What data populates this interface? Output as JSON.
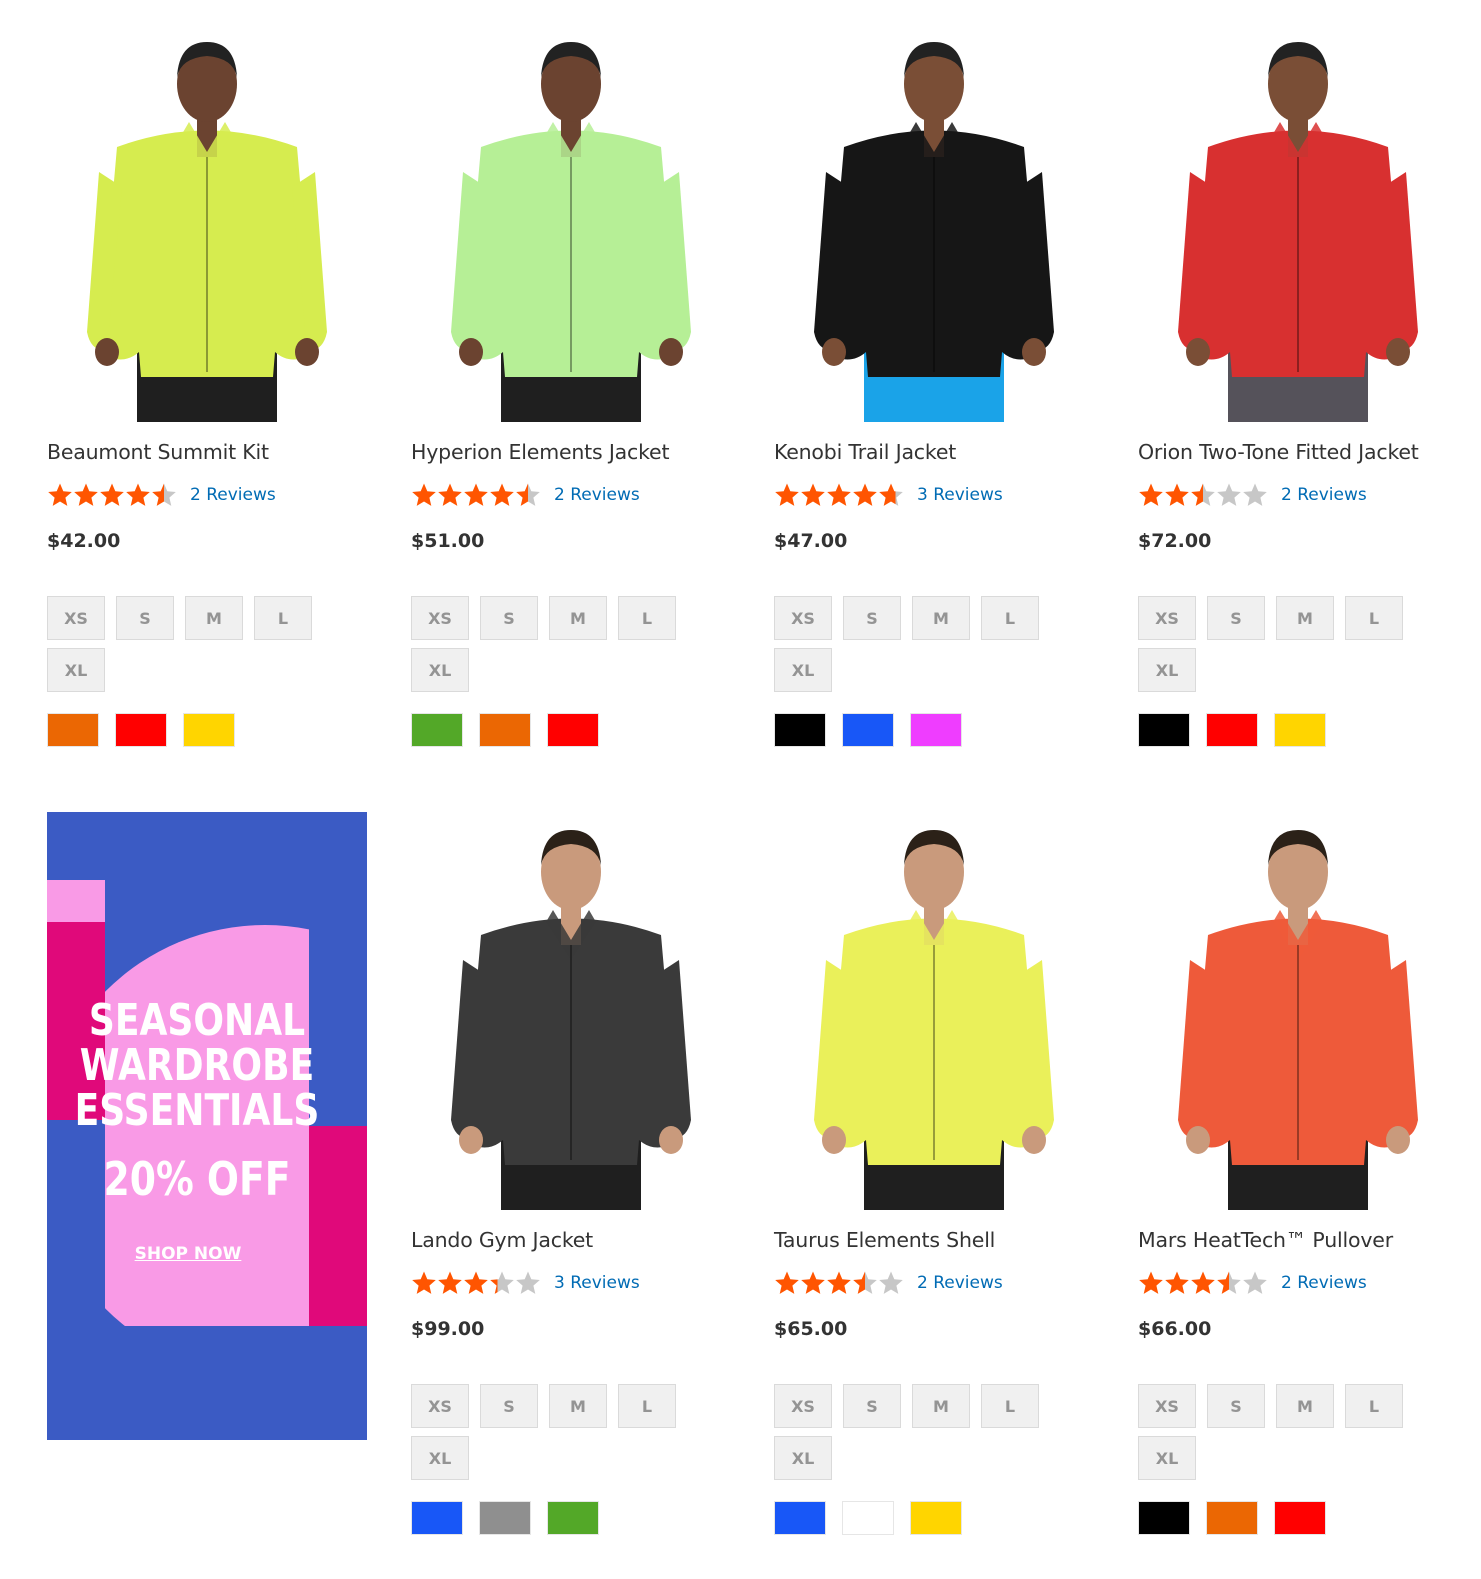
{
  "products": [
    {
      "name": "Beaumont Summit Kit",
      "rating": 4.5,
      "reviews": "2  Reviews",
      "price": "$42.00",
      "sizes": [
        "XS",
        "S",
        "M",
        "L",
        "XL"
      ],
      "colors": [
        "#eb6703",
        "#ff0000",
        "#ffd500"
      ],
      "jacket": "#d6ec4f",
      "pants": "#1f1f1f",
      "skin": "#6b4330",
      "hair": "#222"
    },
    {
      "name": "Hyperion Elements Jacket",
      "rating": 4.5,
      "reviews": "2  Reviews",
      "price": "$51.00",
      "sizes": [
        "XS",
        "S",
        "M",
        "L",
        "XL"
      ],
      "colors": [
        "#53a828",
        "#eb6703",
        "#ff0000"
      ],
      "jacket": "#b6ef96",
      "pants": "#1f1f1f",
      "skin": "#6b4330",
      "hair": "#222"
    },
    {
      "name": "Kenobi Trail Jacket",
      "rating": 4.7,
      "reviews": "3  Reviews",
      "price": "$47.00",
      "sizes": [
        "XS",
        "S",
        "M",
        "L",
        "XL"
      ],
      "colors": [
        "#000000",
        "#1857f7",
        "#ef3dff"
      ],
      "jacket": "#161616",
      "pants": "#1aa3e8",
      "skin": "#7a4e36",
      "hair": "#222"
    },
    {
      "name": "Orion Two-Tone Fitted Jacket",
      "rating": 2.5,
      "reviews": "2  Reviews",
      "price": "$72.00",
      "sizes": [
        "XS",
        "S",
        "M",
        "L",
        "XL"
      ],
      "colors": [
        "#000000",
        "#ff0000",
        "#ffd500"
      ],
      "jacket": "#d83030",
      "pants": "#55525a",
      "skin": "#7a4e36",
      "hair": "#222"
    },
    {
      "name": "Lando Gym Jacket",
      "rating": 3.3,
      "reviews": "3  Reviews",
      "price": "$99.00",
      "sizes": [
        "XS",
        "S",
        "M",
        "L",
        "XL"
      ],
      "colors": [
        "#1857f7",
        "#8f8f8f",
        "#53a828"
      ],
      "jacket": "#3a3a3a",
      "pants": "#1f1f1f",
      "skin": "#c99a7c",
      "hair": "#2b2118"
    },
    {
      "name": "Taurus Elements Shell",
      "rating": 3.5,
      "reviews": "2  Reviews",
      "price": "$65.00",
      "sizes": [
        "XS",
        "S",
        "M",
        "L",
        "XL"
      ],
      "colors": [
        "#1857f7",
        "#ffffff",
        "#ffd500"
      ],
      "jacket": "#eaf05a",
      "pants": "#1f1f1f",
      "skin": "#c99a7c",
      "hair": "#2b2118"
    },
    {
      "name": "Mars HeatTech™ Pullover",
      "rating": 3.5,
      "reviews": "2  Reviews",
      "price": "$66.00",
      "sizes": [
        "XS",
        "S",
        "M",
        "L",
        "XL"
      ],
      "colors": [
        "#000000",
        "#eb6703",
        "#ff0000"
      ],
      "jacket": "#ee5a3a",
      "pants": "#1f1f1f",
      "skin": "#c99a7c",
      "hair": "#2b2118"
    }
  ],
  "promo": {
    "title_lines": [
      "SEASONAL",
      "WARDROBE",
      "ESSENTIALS"
    ],
    "discount": "20% OFF",
    "link": "SHOP NOW",
    "colors": {
      "bg": "#3b5bc4",
      "pink": "#f99ae6",
      "magenta": "#e0097a"
    }
  },
  "colors": {
    "star_on": "#ff5501",
    "star_off": "#c7c7c7",
    "link": "#006bb4"
  }
}
